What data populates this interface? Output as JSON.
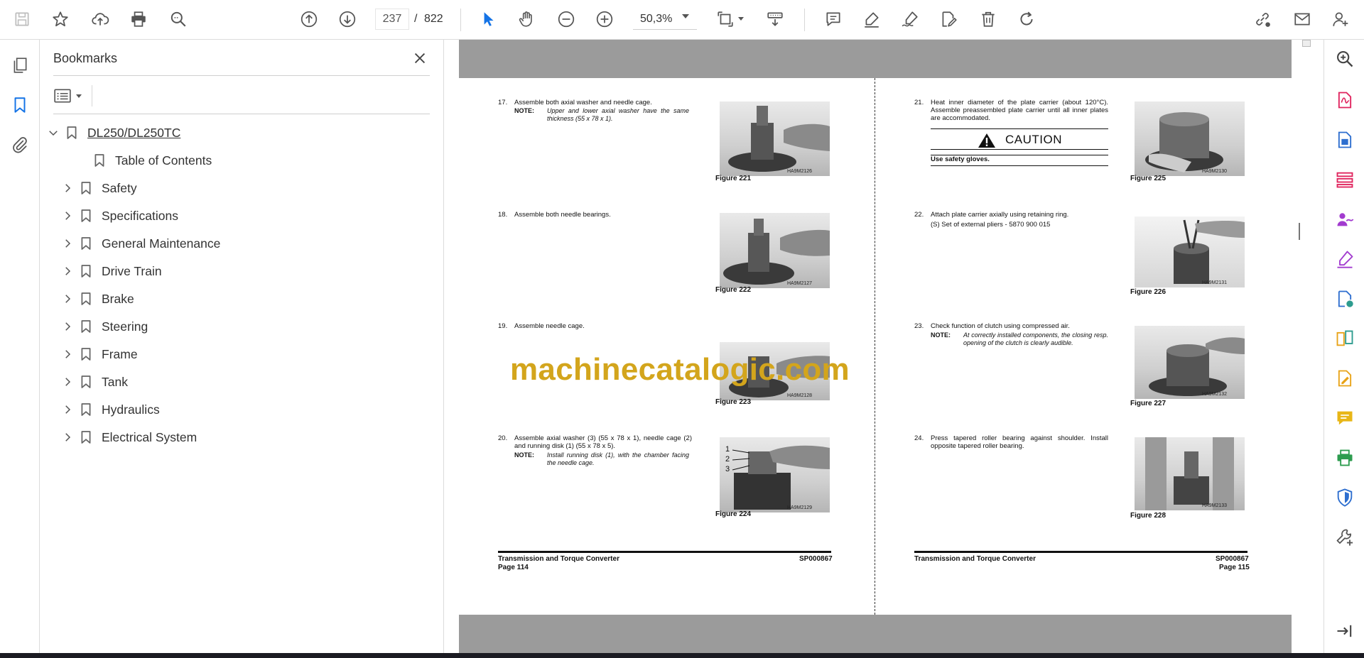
{
  "toolbar": {
    "page_current": "237",
    "page_separator": "/",
    "page_total": "822",
    "zoom": "50,3%",
    "icons": [
      "save-icon",
      "star-icon",
      "upload-icon",
      "print-icon",
      "search-zoom-icon",
      "page-up-icon",
      "page-down-icon",
      "cursor-icon",
      "hand-icon",
      "zoom-out-icon",
      "zoom-in-icon",
      "fit-page-icon",
      "scroll-mode-icon",
      "comment-icon",
      "highlight-icon",
      "sign-icon",
      "edit-text-icon",
      "delete-icon",
      "rotate-icon",
      "share-link-icon",
      "email-icon",
      "account-icon"
    ]
  },
  "left_rail": {
    "icons": [
      "page-thumbnails-icon",
      "bookmarks-icon",
      "attachments-icon"
    ]
  },
  "bookmarks": {
    "title": "Bookmarks",
    "root": "DL250/DL250TC",
    "items": [
      "Table of Contents",
      "Safety",
      "Specifications",
      "General Maintenance",
      "Drive Train",
      "Brake",
      "Steering",
      "Frame",
      "Tank",
      "Hydraulics",
      "Electrical System"
    ]
  },
  "document": {
    "watermark": "machinecatalogic.com",
    "left_page": {
      "steps": [
        {
          "num": "17.",
          "text": "Assemble both axial washer and needle cage.",
          "note_label": "NOTE:",
          "note": "Upper and lower axial washer have the same thickness (55 x 78 x 1).",
          "figure": "Figure 221",
          "code": "HA9M2126"
        },
        {
          "num": "18.",
          "text": "Assemble both needle bearings.",
          "figure": "Figure 222",
          "code": "HA9M2127"
        },
        {
          "num": "19.",
          "text": "Assemble needle cage.",
          "figure": "Figure 223",
          "code": "HA9M2128"
        },
        {
          "num": "20.",
          "text": "Assemble axial washer (3) (55 x 78 x 1), needle cage (2) and running disk (1) (55 x 78 x 5).",
          "note_label": "NOTE:",
          "note": "Install running disk (1), with the chamber facing the needle cage.",
          "figure": "Figure 224",
          "code": "HA9M2129",
          "callouts": [
            "1",
            "2",
            "3"
          ]
        }
      ],
      "footer_title": "Transmission and Torque Converter",
      "footer_code": "SP000867",
      "footer_page": "Page 114"
    },
    "right_page": {
      "steps": [
        {
          "num": "21.",
          "text": "Heat inner diameter of the plate carrier (about 120°C). Assemble preassembled plate carrier until all inner plates are accommodated.",
          "caution_title": "CAUTION",
          "caution_text": "Use safety gloves.",
          "figure": "Figure 225",
          "code": "HA9M2130"
        },
        {
          "num": "22.",
          "text": "Attach plate carrier axially using retaining ring.",
          "subtext": "(S) Set of external pliers - 5870 900 015",
          "figure": "Figure 226",
          "code": "HA9M2131"
        },
        {
          "num": "23.",
          "text": "Check function of clutch using compressed air.",
          "note_label": "NOTE:",
          "note": "At correctly installed components, the closing resp. opening of the clutch is clearly audible.",
          "figure": "Figure 227",
          "code": "HA9M2132"
        },
        {
          "num": "24.",
          "text": "Press tapered roller bearing against shoulder. Install opposite tapered roller bearing.",
          "figure": "Figure 228",
          "code": "HA9M2133"
        }
      ],
      "footer_title": "Transmission and Torque Converter",
      "footer_code": "SP000867",
      "footer_page": "Page 115"
    }
  },
  "right_rail": {
    "icons": [
      "zoom-tool-icon",
      "export-pdf-icon",
      "create-pdf-icon",
      "organize-pages-icon",
      "request-signature-icon",
      "fill-sign-icon",
      "send-for-review-icon",
      "compare-icon",
      "edit-pdf-icon",
      "comment-tool-icon",
      "print-production-icon",
      "protect-icon",
      "more-tools-icon",
      "collapse-panel-icon"
    ]
  }
}
